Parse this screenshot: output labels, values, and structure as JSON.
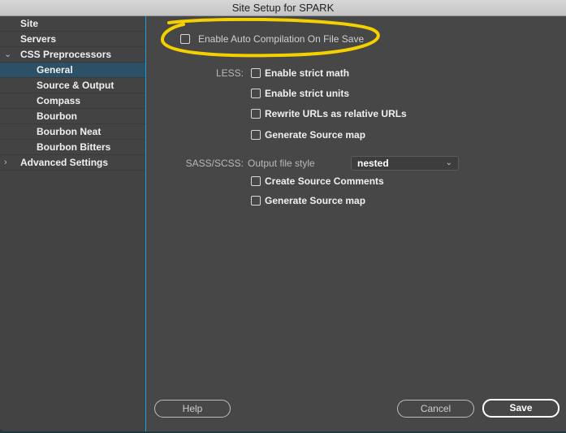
{
  "window": {
    "title": "Site Setup for SPARK"
  },
  "sidebar": {
    "items": [
      {
        "label": "Site",
        "level": 1,
        "expander": ""
      },
      {
        "label": "Servers",
        "level": 1,
        "expander": ""
      },
      {
        "label": "CSS Preprocessors",
        "level": 1,
        "expander": "chevron-down"
      },
      {
        "label": "General",
        "level": 2,
        "expander": "",
        "selected": true
      },
      {
        "label": "Source & Output",
        "level": 2,
        "expander": ""
      },
      {
        "label": "Compass",
        "level": 2,
        "expander": ""
      },
      {
        "label": "Bourbon",
        "level": 2,
        "expander": ""
      },
      {
        "label": "Bourbon Neat",
        "level": 2,
        "expander": ""
      },
      {
        "label": "Bourbon Bitters",
        "level": 2,
        "expander": ""
      },
      {
        "label": "Advanced Settings",
        "level": 1,
        "expander": "chevron-right"
      }
    ],
    "chevron_down_glyph": "⌄",
    "chevron_right_glyph": "›"
  },
  "main": {
    "auto_compile": {
      "label": "Enable Auto Compilation On File Save",
      "checked": false
    },
    "highlight_color": "#f5d000",
    "less": {
      "section_label": "LESS:",
      "options": [
        {
          "label": "Enable strict math",
          "checked": false
        },
        {
          "label": "Enable strict units",
          "checked": false
        },
        {
          "label": "Rewrite URLs as relative URLs",
          "checked": false
        },
        {
          "label": "Generate Source map",
          "checked": false
        }
      ]
    },
    "sass": {
      "section_label": "SASS/SCSS:",
      "output_style_label": "Output file style",
      "output_style_value": "nested",
      "options": [
        {
          "label": "Create Source Comments",
          "checked": false
        },
        {
          "label": "Generate Source map",
          "checked": false
        }
      ]
    }
  },
  "footer": {
    "help_label": "Help",
    "cancel_label": "Cancel",
    "save_label": "Save"
  },
  "colors": {
    "accent": "#1a9fe0",
    "selected_row": "#2c5166",
    "panel": "#474747",
    "sidebar": "#434343"
  }
}
